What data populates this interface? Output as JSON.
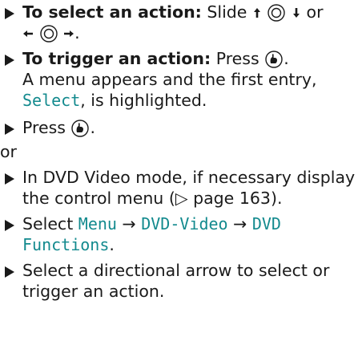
{
  "items": [
    {
      "bold": "To select an action:",
      "text_a": "Slide",
      "text_or": "or"
    },
    {
      "bold": "To trigger an action:",
      "text_a": "Press",
      "text_b": ".",
      "line2": "A menu appears and the first entry,",
      "ui": "Select",
      "line3_tail": ", is highlighted."
    },
    {
      "text_a": "Press",
      "text_b": "."
    },
    {
      "line1": "In DVD Video mode, if necessary display",
      "line2": "the control menu (▷ page 163)."
    },
    {
      "text_a": "Select",
      "ui1": "Menu",
      "arrow": "→",
      "ui2": "DVD-Video",
      "ui3a": "DVD",
      "ui3b": "Functions",
      "end": "."
    },
    {
      "line1": "Select a directional arrow to select or",
      "line2": "trigger an action."
    }
  ],
  "or_text": "or",
  "icons": {
    "up_arrow": "slide-up-icon",
    "down_arrow": "slide-down-icon",
    "left_arrow": "slide-left-icon",
    "right_arrow": "slide-right-icon",
    "controller": "controller-icon",
    "press": "press-controller-icon"
  }
}
